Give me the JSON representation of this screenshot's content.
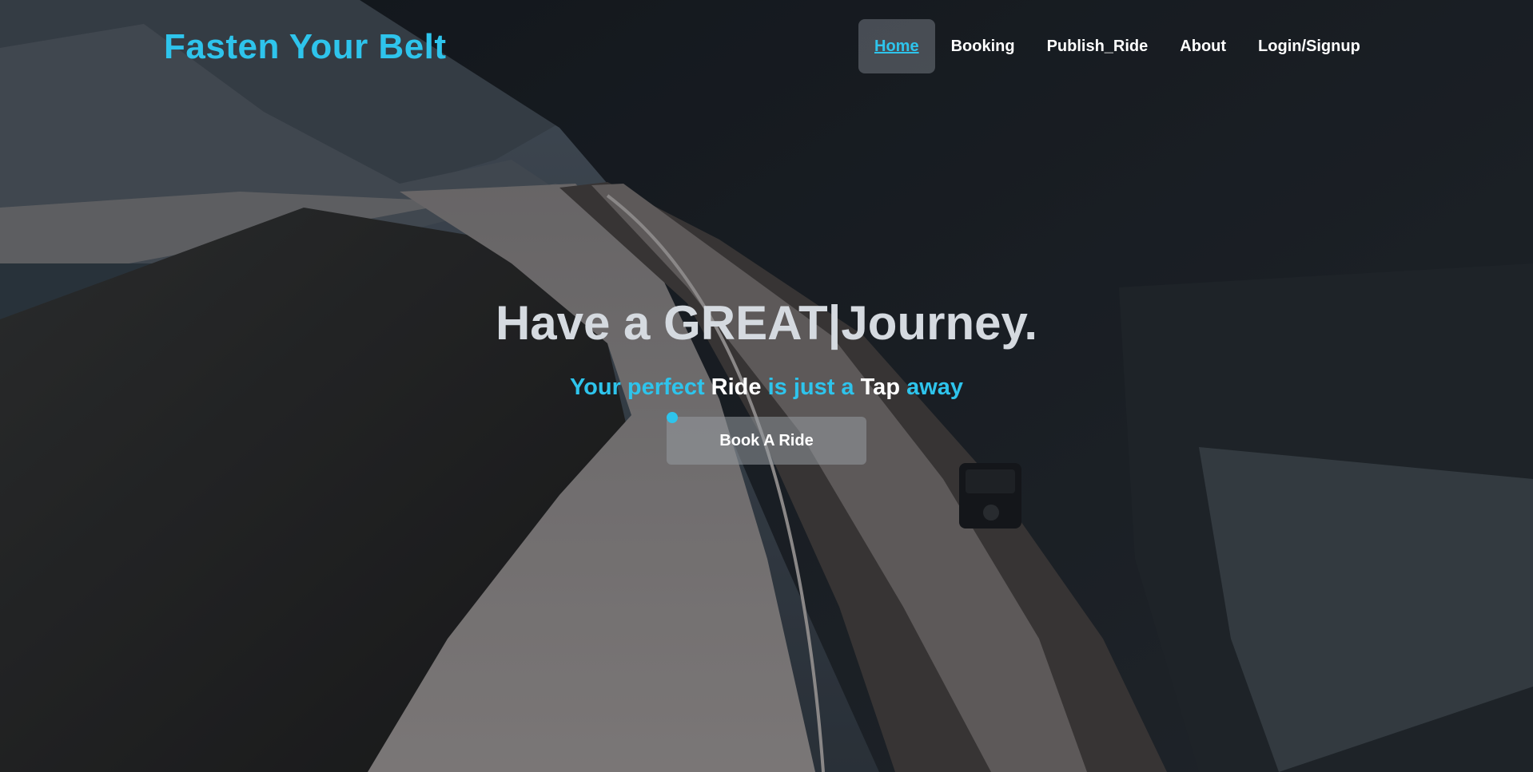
{
  "brand": {
    "name": "Fasten Your Belt",
    "color": "#2ec4ec"
  },
  "nav": {
    "items": [
      {
        "label": "Home",
        "active": true
      },
      {
        "label": "Booking",
        "active": false
      },
      {
        "label": "Publish_Ride",
        "active": false
      },
      {
        "label": "About",
        "active": false
      },
      {
        "label": "Login/Signup",
        "active": false
      }
    ]
  },
  "hero": {
    "headline": "Have a GREAT|Journey.",
    "tagline": [
      {
        "text": "Your perfect ",
        "style": "accent"
      },
      {
        "text": "Ride",
        "style": "plain"
      },
      {
        "text": " is just a ",
        "style": "accent"
      },
      {
        "text": "Tap",
        "style": "plain"
      },
      {
        "text": " away",
        "style": "accent"
      }
    ],
    "cta_label": "Book A Ride",
    "background": "aerial-snowy-mountain-road-photo"
  }
}
